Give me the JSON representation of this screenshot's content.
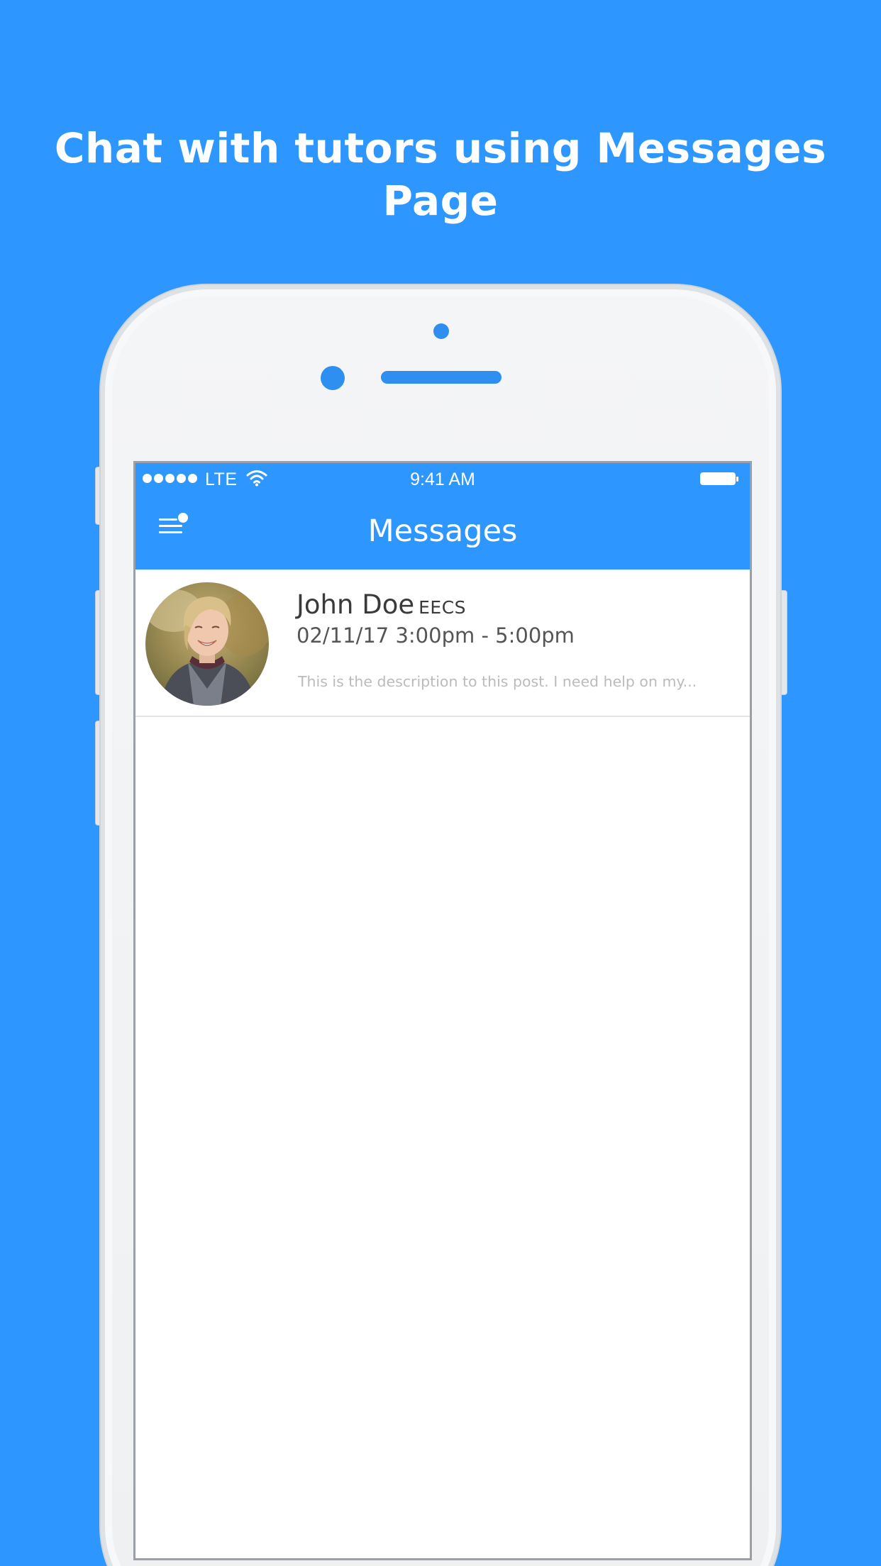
{
  "promo": {
    "headline": "Chat with tutors using Messages Page"
  },
  "status_bar": {
    "carrier": "LTE",
    "time": "9:41 AM",
    "signal_dots": 5
  },
  "nav": {
    "title": "Messages",
    "menu_icon": "menu-icon",
    "notification_dot": true
  },
  "messages": [
    {
      "name": "John Doe",
      "department": "EECS",
      "time": "02/11/17 3:00pm - 5:00pm",
      "preview": "This is the description to this post.  I need help on my..."
    }
  ],
  "colors": {
    "brand": "#2e96ff",
    "background": "#2e96ff",
    "screen": "#ffffff",
    "name_text": "#3a3a3a",
    "preview_text": "#bbbbbb"
  }
}
